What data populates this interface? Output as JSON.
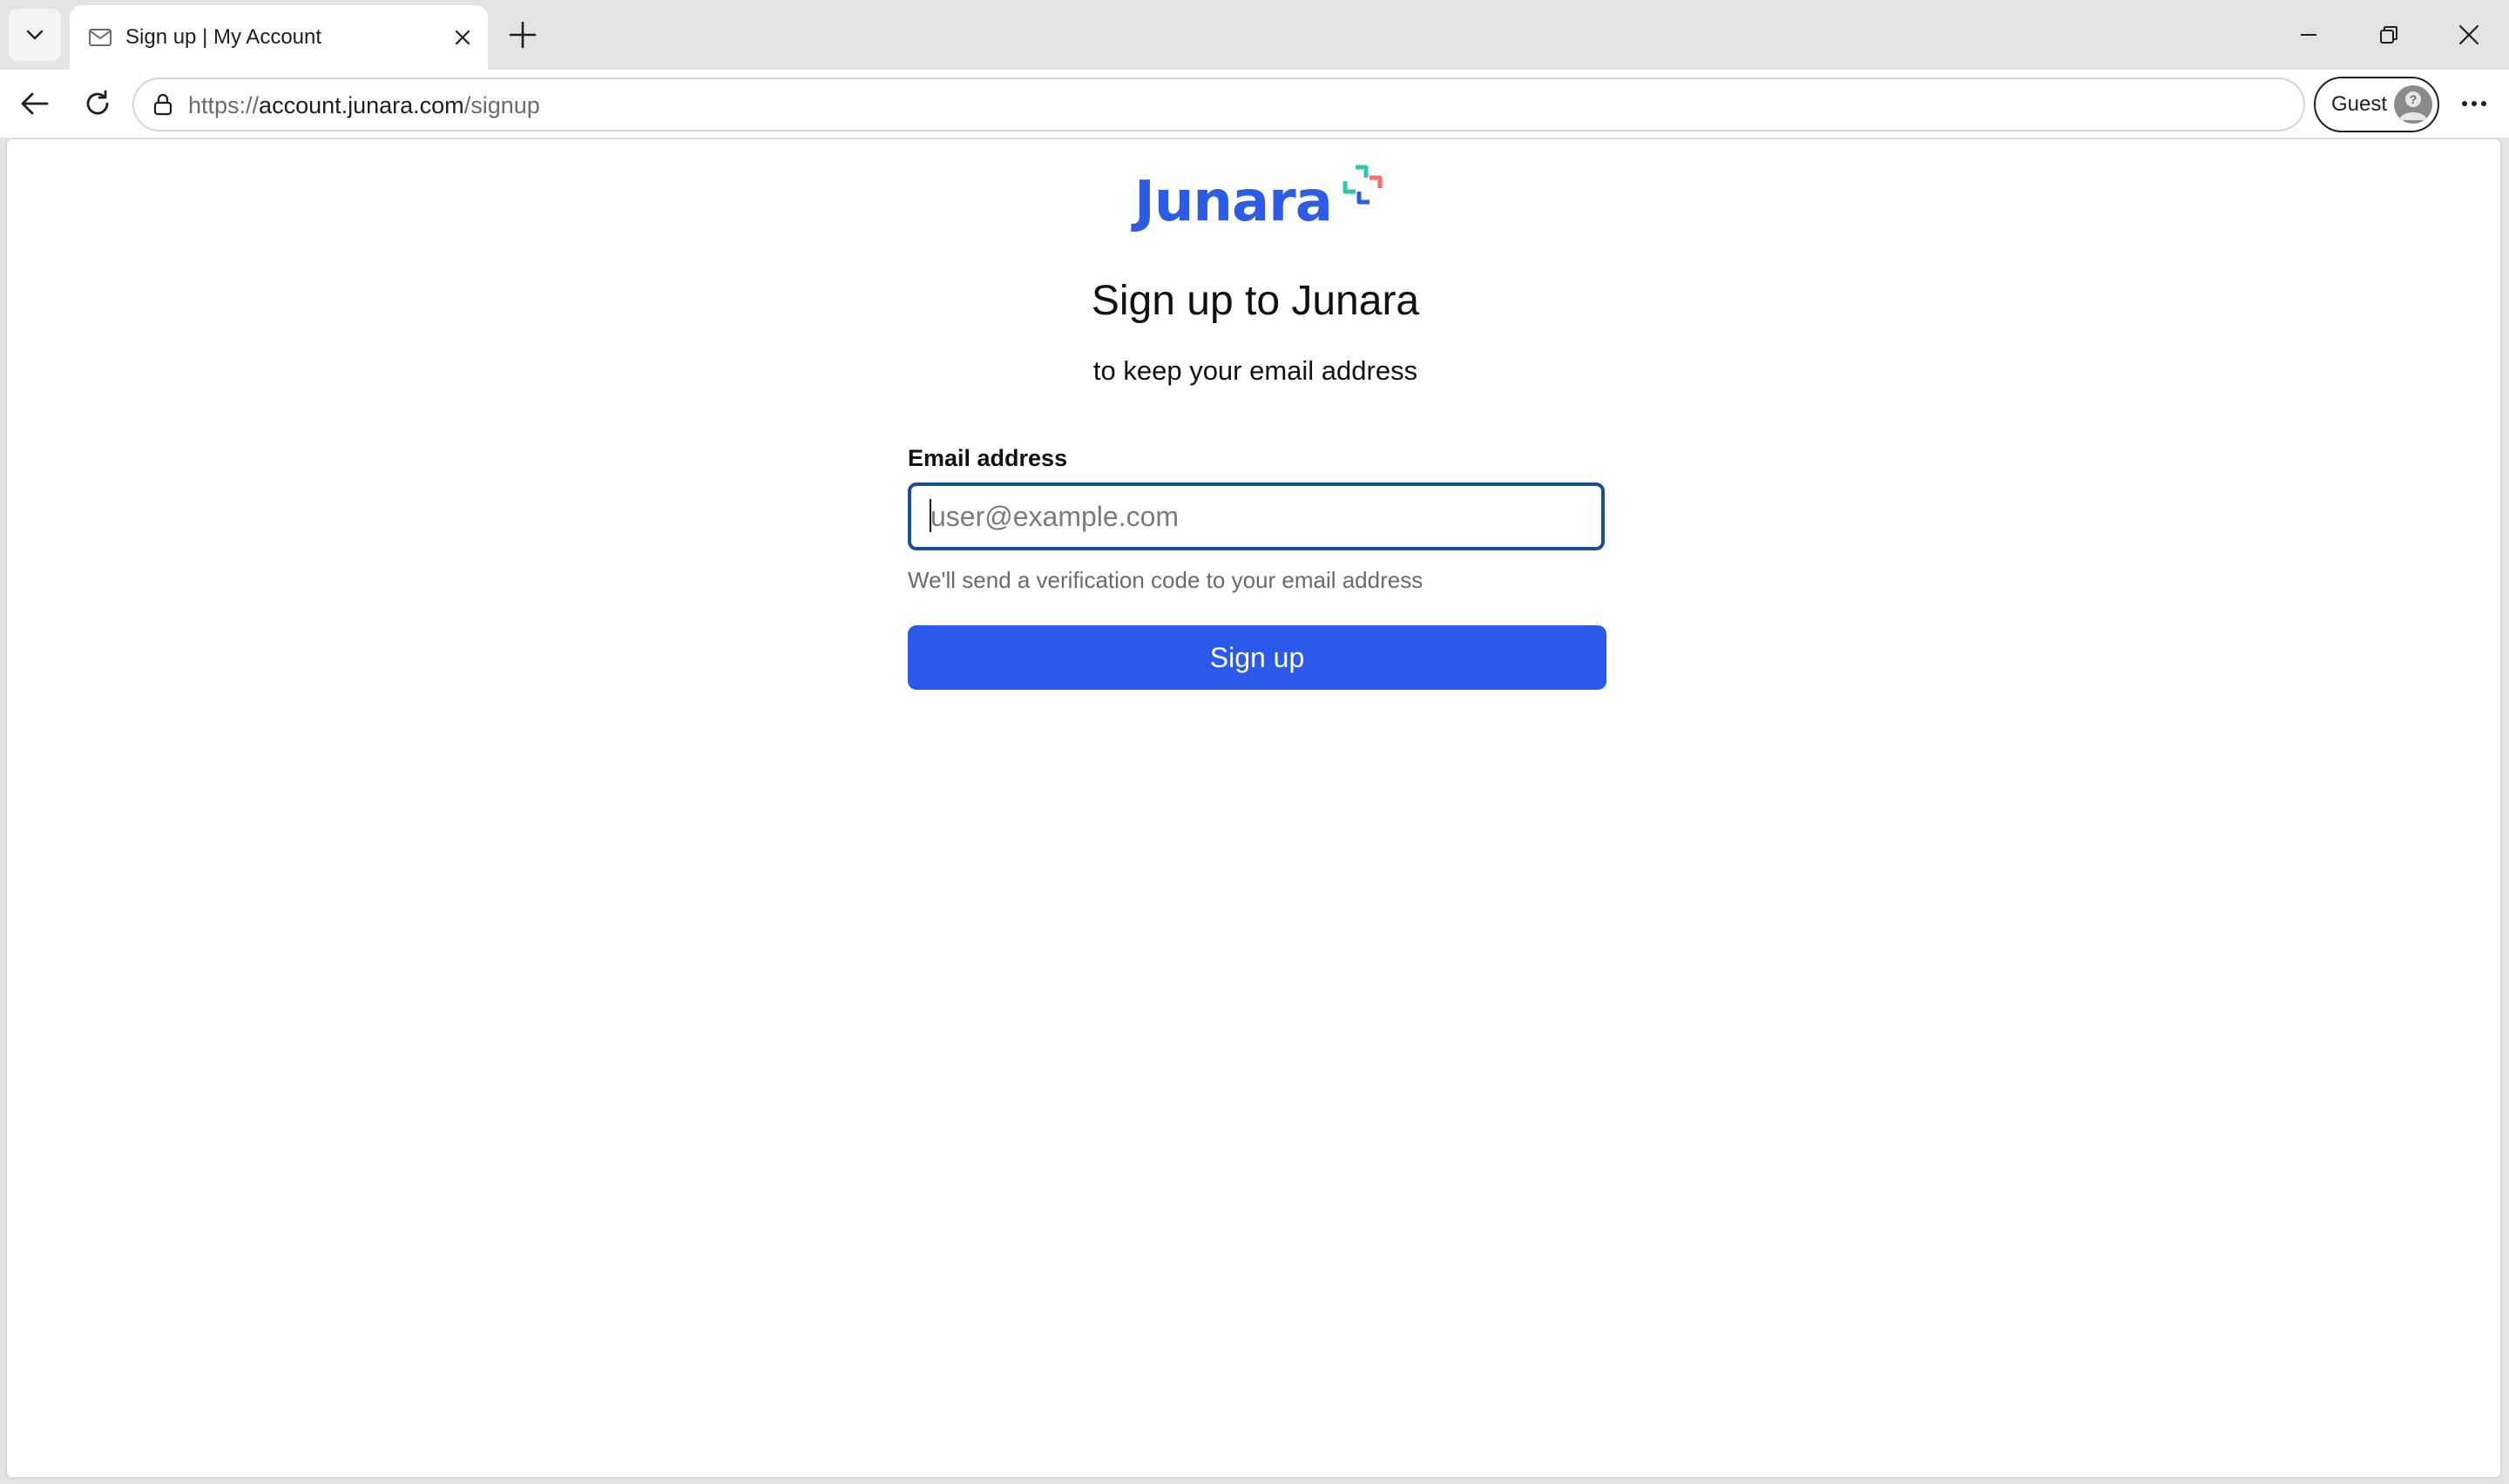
{
  "browser": {
    "tab": {
      "title": "Sign up | My Account",
      "favicon": "mail-icon"
    },
    "address": {
      "url_prefix": "https://",
      "url_host": "account.junara.com",
      "url_path": "/signup"
    },
    "profile": {
      "label": "Guest"
    }
  },
  "page": {
    "logo": {
      "text": "Junara",
      "brand_color": "#2d5be3"
    },
    "heading": "Sign up to Junara",
    "subheading": "to keep your email address",
    "form": {
      "email_label": "Email address",
      "email_value": "",
      "email_placeholder": "user@example.com",
      "helper_text": "We'll send a verification code to your email address",
      "submit_label": "Sign up",
      "submit_color": "#2b59ea"
    }
  }
}
